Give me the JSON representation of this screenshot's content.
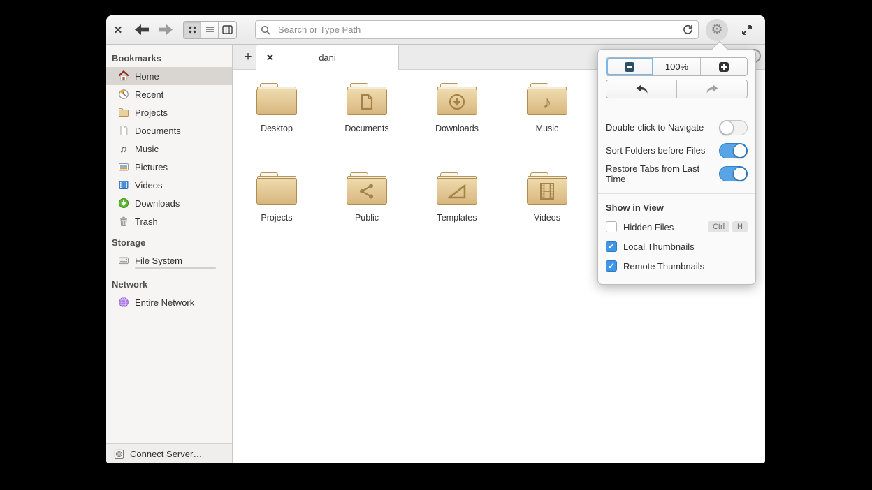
{
  "header": {
    "search": {
      "placeholder": "Search or Type Path",
      "value": ""
    },
    "icons": {
      "window_close": "✕",
      "gear": "⚙"
    }
  },
  "sidebar": {
    "sections": [
      {
        "title": "Bookmarks",
        "items": [
          {
            "label": "Home",
            "icon": "home-icon",
            "selected": true
          },
          {
            "label": "Recent",
            "icon": "recent-icon"
          },
          {
            "label": "Projects",
            "icon": "folder-icon"
          },
          {
            "label": "Documents",
            "icon": "document-icon"
          },
          {
            "label": "Music",
            "icon": "music-icon",
            "glyph": "♫"
          },
          {
            "label": "Pictures",
            "icon": "pictures-icon"
          },
          {
            "label": "Videos",
            "icon": "videos-icon"
          },
          {
            "label": "Downloads",
            "icon": "downloads-icon"
          },
          {
            "label": "Trash",
            "icon": "trash-icon"
          }
        ]
      },
      {
        "title": "Storage",
        "items": [
          {
            "label": "File System",
            "icon": "harddisk-icon",
            "usage_percent": 35
          }
        ]
      },
      {
        "title": "Network",
        "items": [
          {
            "label": "Entire Network",
            "icon": "network-icon"
          }
        ]
      }
    ],
    "connect_server_label": "Connect Server…"
  },
  "tabbar": {
    "new_tab": "+",
    "tabs": [
      {
        "title": "dani",
        "active": true,
        "close": "✕"
      }
    ]
  },
  "main": {
    "folders": [
      {
        "label": "Desktop",
        "glyph": "plain"
      },
      {
        "label": "Documents",
        "glyph": "document"
      },
      {
        "label": "Downloads",
        "glyph": "download"
      },
      {
        "label": "Music",
        "glyph": "music-note",
        "glyph_char": "♪"
      },
      {
        "label": "Projects",
        "glyph": "plain"
      },
      {
        "label": "Public",
        "glyph": "share"
      },
      {
        "label": "Templates",
        "glyph": "triangle-ruler"
      },
      {
        "label": "Videos",
        "glyph": "film-strip"
      }
    ]
  },
  "popover": {
    "zoom": {
      "out_icon": "minus",
      "level": "100%",
      "in_icon": "plus"
    },
    "history": {
      "back_icon": "undo-arrow",
      "forward_icon": "redo-arrow"
    },
    "toggles": [
      {
        "label": "Double-click to Navigate",
        "on": false
      },
      {
        "label": "Sort Folders before Files",
        "on": true
      },
      {
        "label": "Restore Tabs from Last Time",
        "on": true
      }
    ],
    "section_title": "Show in View",
    "checkboxes": [
      {
        "label": "Hidden Files",
        "checked": false,
        "shortcut": [
          "Ctrl",
          "H"
        ],
        "checkmark": ""
      },
      {
        "label": "Local Thumbnails",
        "checked": true,
        "checkmark": "✓"
      },
      {
        "label": "Remote Thumbnails",
        "checked": true,
        "checkmark": "✓"
      }
    ]
  },
  "colors": {
    "accent_blue": "#58a4e6",
    "checkbox_blue": "#3f96e6",
    "folder_tan_top": "#eedbad",
    "folder_tan_bottom": "#d8b77e",
    "folder_glyph": "#a5824a",
    "sidebar_bg": "#f6f5f4",
    "selection_gray": "#d9d6d2"
  }
}
